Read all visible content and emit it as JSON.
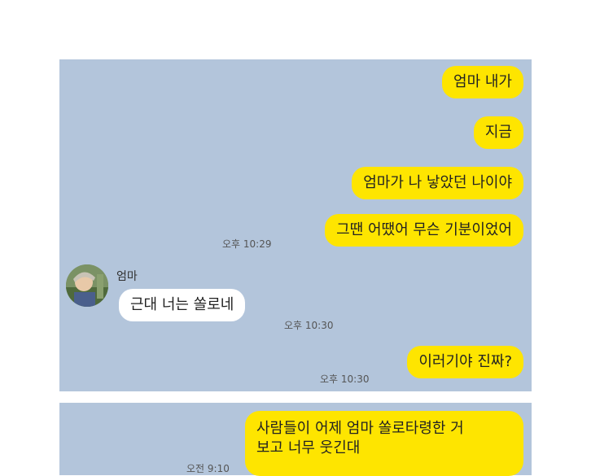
{
  "chat1": {
    "messages_out": [
      "엄마 내가",
      "지금",
      "엄마가 나 낳았던 나이야",
      "그땐 어땠어 무슨 기분이었어"
    ],
    "time_out_1": "오후 10:29",
    "sender_name": "엄마",
    "message_in": "근대 너는  쏠로네",
    "time_in": "오후 10:30",
    "message_out_final": "이러기야 진짜?",
    "time_out_final": "오후 10:30"
  },
  "chat2": {
    "message_line1": "사람들이 어제 엄마 쏠로타령한 거",
    "message_line2": "보고 너무 웃긴대",
    "time": "오전 9:10"
  },
  "colors": {
    "chat_background": "#b3c5db",
    "outgoing_bubble": "#fee500",
    "incoming_bubble": "#ffffff"
  }
}
